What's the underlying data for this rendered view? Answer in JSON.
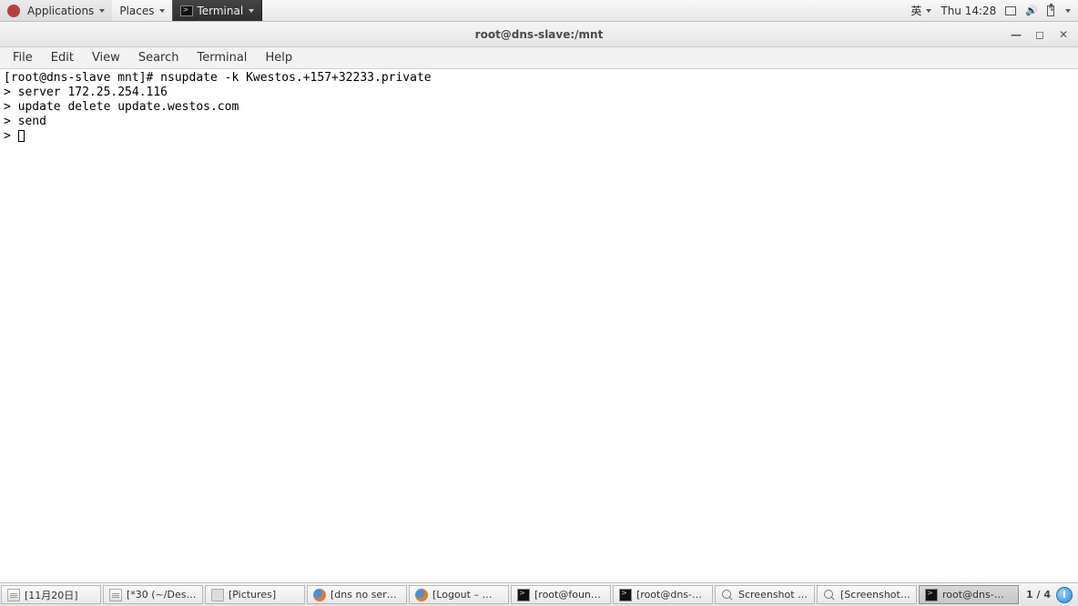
{
  "top": {
    "apps": "Applications",
    "places": "Places",
    "task_terminal": "Terminal",
    "ime": "英",
    "clock": "Thu 14:28"
  },
  "window": {
    "title": "root@dns-slave:/mnt",
    "menus": {
      "file": "File",
      "edit": "Edit",
      "view": "View",
      "search": "Search",
      "terminal": "Terminal",
      "help": "Help"
    }
  },
  "terminal": {
    "line1": "[root@dns-slave mnt]# nsupdate -k Kwestos.+157+32233.private",
    "line2": "> server 172.25.254.116",
    "line3": "> update delete update.westos.com",
    "line4": "> send",
    "line5": "> "
  },
  "bottom": {
    "tasks": [
      {
        "icon": "gedit",
        "label": "[11月20日]"
      },
      {
        "icon": "gedit",
        "label": "[*30 (~/Des…"
      },
      {
        "icon": "folder",
        "label": "[Pictures]"
      },
      {
        "icon": "firefox",
        "label": "[dns no ser…"
      },
      {
        "icon": "firefox",
        "label": "[Logout – …"
      },
      {
        "icon": "term",
        "label": "[root@foun…"
      },
      {
        "icon": "term",
        "label": "[root@dns-…"
      },
      {
        "icon": "search",
        "label": "Screenshot …"
      },
      {
        "icon": "search",
        "label": "[Screenshot…"
      },
      {
        "icon": "term",
        "label": "root@dns-…",
        "active": true
      }
    ],
    "workspace": "1 / 4"
  }
}
